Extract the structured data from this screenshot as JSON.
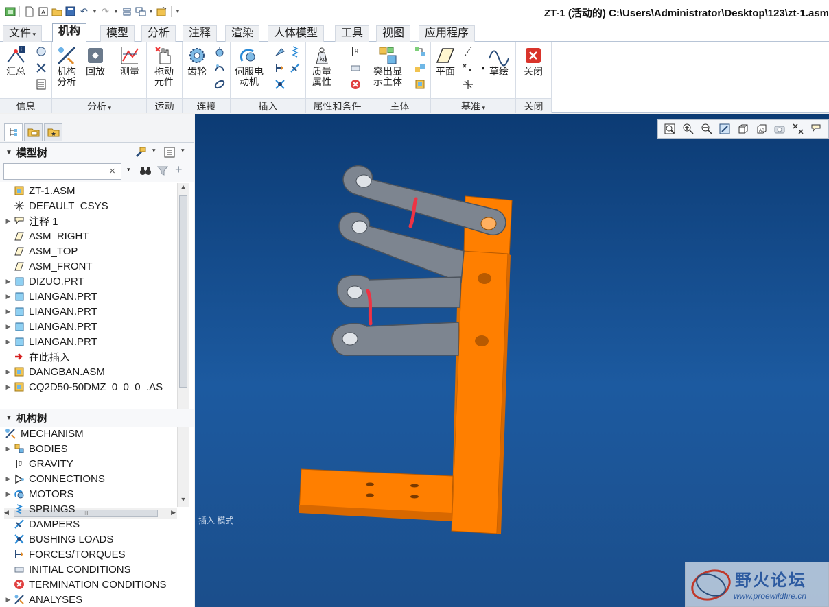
{
  "window": {
    "title": "ZT-1 (活动的) C:\\Users\\Administrator\\Desktop\\123\\zt-1.asm"
  },
  "menu_tabs": [
    "文件",
    "机构",
    "模型",
    "分析",
    "注释",
    "渲染",
    "人体模型",
    "工具",
    "视图",
    "应用程序"
  ],
  "ribbon": {
    "groups": {
      "info": "信息",
      "analysis": "分析",
      "motion": "运动",
      "connect": "连接",
      "insert": "插入",
      "props": "属性和条件",
      "body": "主体",
      "datum": "基准",
      "close": "关闭"
    },
    "buttons": {
      "summary": "汇总",
      "mech_analysis": "机构\n分析",
      "playback": "回放",
      "measure": "测量",
      "drag": "拖动\n元件",
      "gear": "齿轮",
      "servo_motor": "伺服电\n动机",
      "mass_props": "质量\n属性",
      "highlight_body": "突出显\n示主体",
      "plane": "平面",
      "sketch": "草绘",
      "close": "关闭"
    }
  },
  "model_tree": {
    "header": "模型树",
    "search_clear": "×",
    "items": [
      {
        "label": "ZT-1.ASM",
        "icon": "assembly-icon",
        "expand": ""
      },
      {
        "label": "DEFAULT_CSYS",
        "icon": "csys-icon",
        "expand": ""
      },
      {
        "label": "注释 1",
        "icon": "annotation-icon",
        "expand": "▶"
      },
      {
        "label": "ASM_RIGHT",
        "icon": "datum-plane-icon",
        "expand": ""
      },
      {
        "label": "ASM_TOP",
        "icon": "datum-plane-icon",
        "expand": ""
      },
      {
        "label": "ASM_FRONT",
        "icon": "datum-plane-icon",
        "expand": ""
      },
      {
        "label": "DIZUO.PRT",
        "icon": "part-icon",
        "expand": "▶"
      },
      {
        "label": "LIANGAN.PRT",
        "icon": "part-icon",
        "expand": "▶"
      },
      {
        "label": "LIANGAN.PRT",
        "icon": "part-icon",
        "expand": "▶"
      },
      {
        "label": "LIANGAN.PRT",
        "icon": "part-icon",
        "expand": "▶"
      },
      {
        "label": "LIANGAN.PRT",
        "icon": "part-icon",
        "expand": "▶"
      },
      {
        "label": "在此插入",
        "icon": "insert-here-icon",
        "expand": ""
      },
      {
        "label": "DANGBAN.ASM",
        "icon": "assembly-icon",
        "expand": "▶"
      },
      {
        "label": "CQ2D50-50DMZ_0_0_0_.AS",
        "icon": "assembly-icon",
        "expand": "▶"
      }
    ],
    "hscroll_label": "III"
  },
  "mechanism_tree": {
    "header": "机构树",
    "items": [
      {
        "label": "MECHANISM",
        "icon": "mechanism-icon",
        "expand": ""
      },
      {
        "label": "BODIES",
        "icon": "bodies-icon",
        "expand": "▶"
      },
      {
        "label": "GRAVITY",
        "icon": "gravity-icon",
        "expand": ""
      },
      {
        "label": "CONNECTIONS",
        "icon": "connections-icon",
        "expand": "▶"
      },
      {
        "label": "MOTORS",
        "icon": "motors-icon",
        "expand": "▶"
      },
      {
        "label": "SPRINGS",
        "icon": "springs-icon",
        "expand": ""
      },
      {
        "label": "DAMPERS",
        "icon": "dampers-icon",
        "expand": ""
      },
      {
        "label": "BUSHING LOADS",
        "icon": "bushing-icon",
        "expand": ""
      },
      {
        "label": "FORCES/TORQUES",
        "icon": "forces-icon",
        "expand": ""
      },
      {
        "label": "INITIAL CONDITIONS",
        "icon": "initial-conditions-icon",
        "expand": ""
      },
      {
        "label": "TERMINATION CONDITIONS",
        "icon": "termination-icon",
        "expand": ""
      },
      {
        "label": "ANALYSES",
        "icon": "analyses-icon",
        "expand": "▶"
      }
    ]
  },
  "viewport": {
    "mode_text": "插入 模式",
    "watermark_title": "野火论坛",
    "watermark_url": "www.proewildfire.cn"
  },
  "colors": {
    "accent_orange": "#ff7f00",
    "link_grey": "#7d8590",
    "viewport_bg": "#1c5aa0",
    "highlight_red": "#ee3344"
  }
}
